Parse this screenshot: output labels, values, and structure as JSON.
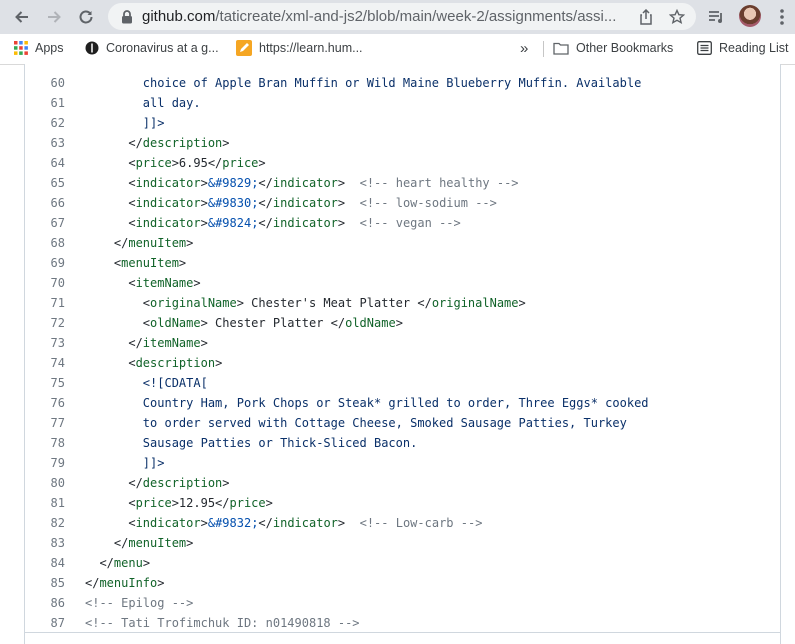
{
  "browser": {
    "url_host": "github.com",
    "url_path": "/taticreate/xml-and-js2/blob/main/week-2/assignments/assi...",
    "icons": [
      "back-icon",
      "forward-icon",
      "reload-icon",
      "lock-icon",
      "share-icon",
      "star-icon",
      "reading-list-icon",
      "avatar",
      "kebab-menu-icon"
    ]
  },
  "bookmarks": {
    "apps": "Apps",
    "items": [
      {
        "label": "Coronavirus at a g..."
      },
      {
        "label": "https://learn.hum..."
      }
    ],
    "overflow": "»",
    "other": "Other Bookmarks",
    "reading_list": "Reading List"
  },
  "code": {
    "lines": [
      {
        "n": "60",
        "segs": [
          {
            "t": "        choice of Apple Bran Muffin or Wild Maine Blueberry Muffin. Available",
            "c": "str"
          }
        ]
      },
      {
        "n": "61",
        "segs": [
          {
            "t": "        all day.",
            "c": "str"
          }
        ]
      },
      {
        "n": "62",
        "segs": [
          {
            "t": "        ]]>",
            "c": "str"
          }
        ]
      },
      {
        "n": "63",
        "segs": [
          {
            "t": "      </",
            "c": ""
          },
          {
            "t": "description",
            "c": "tag"
          },
          {
            "t": ">",
            "c": ""
          }
        ]
      },
      {
        "n": "64",
        "segs": [
          {
            "t": "      <",
            "c": ""
          },
          {
            "t": "price",
            "c": "tag"
          },
          {
            "t": ">6.95</",
            "c": ""
          },
          {
            "t": "price",
            "c": "tag"
          },
          {
            "t": ">",
            "c": ""
          }
        ]
      },
      {
        "n": "65",
        "segs": [
          {
            "t": "      <",
            "c": ""
          },
          {
            "t": "indicator",
            "c": "tag"
          },
          {
            "t": ">",
            "c": ""
          },
          {
            "t": "&#9829;",
            "c": "ent"
          },
          {
            "t": "</",
            "c": ""
          },
          {
            "t": "indicator",
            "c": "tag"
          },
          {
            "t": ">  ",
            "c": ""
          },
          {
            "t": "<!-- heart healthy -->",
            "c": "cmt"
          }
        ]
      },
      {
        "n": "66",
        "segs": [
          {
            "t": "      <",
            "c": ""
          },
          {
            "t": "indicator",
            "c": "tag"
          },
          {
            "t": ">",
            "c": ""
          },
          {
            "t": "&#9830;",
            "c": "ent"
          },
          {
            "t": "</",
            "c": ""
          },
          {
            "t": "indicator",
            "c": "tag"
          },
          {
            "t": ">  ",
            "c": ""
          },
          {
            "t": "<!-- low-sodium -->",
            "c": "cmt"
          }
        ]
      },
      {
        "n": "67",
        "segs": [
          {
            "t": "      <",
            "c": ""
          },
          {
            "t": "indicator",
            "c": "tag"
          },
          {
            "t": ">",
            "c": ""
          },
          {
            "t": "&#9824;",
            "c": "ent"
          },
          {
            "t": "</",
            "c": ""
          },
          {
            "t": "indicator",
            "c": "tag"
          },
          {
            "t": ">  ",
            "c": ""
          },
          {
            "t": "<!-- vegan -->",
            "c": "cmt"
          }
        ]
      },
      {
        "n": "68",
        "segs": [
          {
            "t": "    </",
            "c": ""
          },
          {
            "t": "menuItem",
            "c": "tag"
          },
          {
            "t": ">",
            "c": ""
          }
        ]
      },
      {
        "n": "69",
        "segs": [
          {
            "t": "    <",
            "c": ""
          },
          {
            "t": "menuItem",
            "c": "tag"
          },
          {
            "t": ">",
            "c": ""
          }
        ]
      },
      {
        "n": "70",
        "segs": [
          {
            "t": "      <",
            "c": ""
          },
          {
            "t": "itemName",
            "c": "tag"
          },
          {
            "t": ">",
            "c": ""
          }
        ]
      },
      {
        "n": "71",
        "segs": [
          {
            "t": "        <",
            "c": ""
          },
          {
            "t": "originalName",
            "c": "tag"
          },
          {
            "t": "> Chester's Meat Platter </",
            "c": ""
          },
          {
            "t": "originalName",
            "c": "tag"
          },
          {
            "t": ">",
            "c": ""
          }
        ]
      },
      {
        "n": "72",
        "segs": [
          {
            "t": "        <",
            "c": ""
          },
          {
            "t": "oldName",
            "c": "tag"
          },
          {
            "t": "> Chester Platter </",
            "c": ""
          },
          {
            "t": "oldName",
            "c": "tag"
          },
          {
            "t": ">",
            "c": ""
          }
        ]
      },
      {
        "n": "73",
        "segs": [
          {
            "t": "      </",
            "c": ""
          },
          {
            "t": "itemName",
            "c": "tag"
          },
          {
            "t": ">",
            "c": ""
          }
        ]
      },
      {
        "n": "74",
        "segs": [
          {
            "t": "      <",
            "c": ""
          },
          {
            "t": "description",
            "c": "tag"
          },
          {
            "t": ">",
            "c": ""
          }
        ]
      },
      {
        "n": "75",
        "segs": [
          {
            "t": "        <![CDATA[",
            "c": "str"
          }
        ]
      },
      {
        "n": "76",
        "segs": [
          {
            "t": "        Country Ham, Pork Chops or Steak* grilled to order, Three Eggs* cooked",
            "c": "str"
          }
        ]
      },
      {
        "n": "77",
        "segs": [
          {
            "t": "        to order served with Cottage Cheese, Smoked Sausage Patties, Turkey",
            "c": "str"
          }
        ]
      },
      {
        "n": "78",
        "segs": [
          {
            "t": "        Sausage Patties or Thick-Sliced Bacon.",
            "c": "str"
          }
        ]
      },
      {
        "n": "79",
        "segs": [
          {
            "t": "        ]]>",
            "c": "str"
          }
        ]
      },
      {
        "n": "80",
        "segs": [
          {
            "t": "      </",
            "c": ""
          },
          {
            "t": "description",
            "c": "tag"
          },
          {
            "t": ">",
            "c": ""
          }
        ]
      },
      {
        "n": "81",
        "segs": [
          {
            "t": "      <",
            "c": ""
          },
          {
            "t": "price",
            "c": "tag"
          },
          {
            "t": ">12.95</",
            "c": ""
          },
          {
            "t": "price",
            "c": "tag"
          },
          {
            "t": ">",
            "c": ""
          }
        ]
      },
      {
        "n": "82",
        "segs": [
          {
            "t": "      <",
            "c": ""
          },
          {
            "t": "indicator",
            "c": "tag"
          },
          {
            "t": ">",
            "c": ""
          },
          {
            "t": "&#9832;",
            "c": "ent"
          },
          {
            "t": "</",
            "c": ""
          },
          {
            "t": "indicator",
            "c": "tag"
          },
          {
            "t": ">  ",
            "c": ""
          },
          {
            "t": "<!-- Low-carb -->",
            "c": "cmt"
          }
        ]
      },
      {
        "n": "83",
        "segs": [
          {
            "t": "    </",
            "c": ""
          },
          {
            "t": "menuItem",
            "c": "tag"
          },
          {
            "t": ">",
            "c": ""
          }
        ]
      },
      {
        "n": "84",
        "segs": [
          {
            "t": "  </",
            "c": ""
          },
          {
            "t": "menu",
            "c": "tag"
          },
          {
            "t": ">",
            "c": ""
          }
        ]
      },
      {
        "n": "85",
        "segs": [
          {
            "t": "</",
            "c": ""
          },
          {
            "t": "menuInfo",
            "c": "tag"
          },
          {
            "t": ">",
            "c": ""
          }
        ]
      },
      {
        "n": "86",
        "segs": [
          {
            "t": "<!-- Epilog -->",
            "c": "cmt"
          }
        ]
      },
      {
        "n": "87",
        "segs": [
          {
            "t": "<!-- Tati Trofimchuk ID: n01490818 -->",
            "c": "cmt"
          }
        ]
      }
    ]
  }
}
